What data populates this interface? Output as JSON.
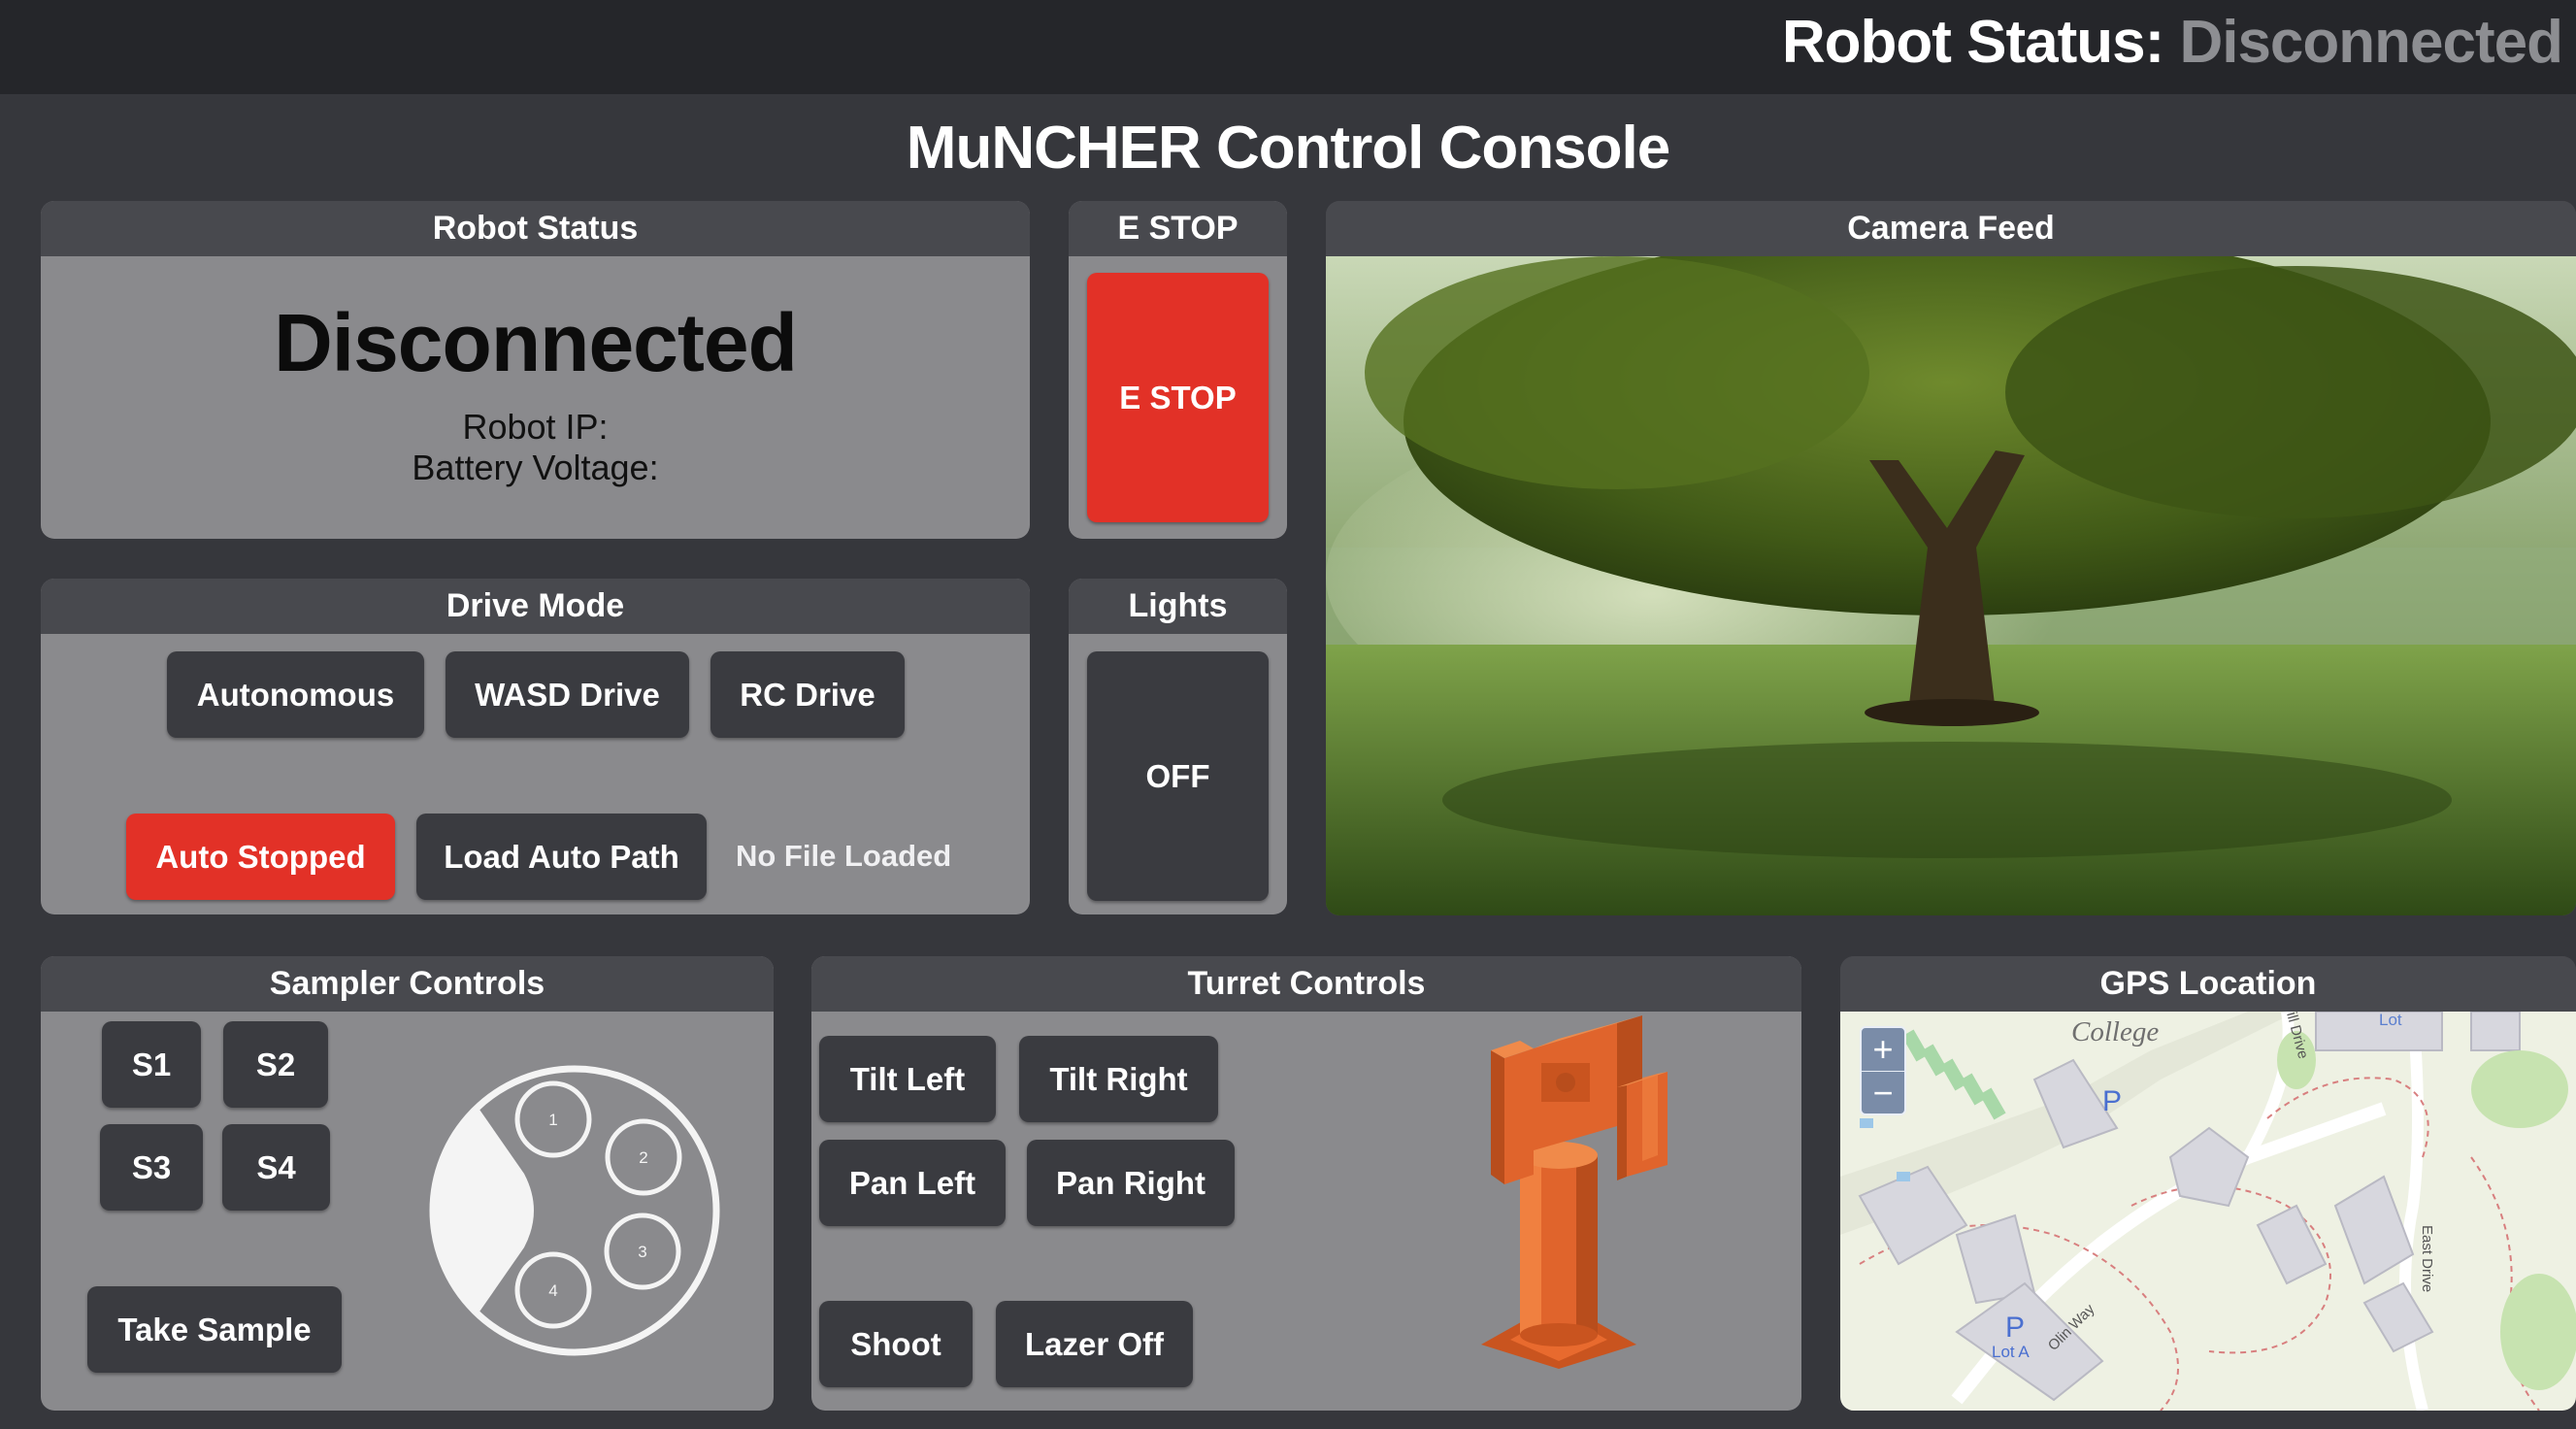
{
  "topbar": {
    "status_label": "Robot Status:",
    "status_value": "Disconnected"
  },
  "title": "MuNCHER Control Console",
  "robot_status": {
    "header": "Robot Status",
    "state": "Disconnected",
    "ip_label": "Robot IP:",
    "battery_label": "Battery Voltage:"
  },
  "estop": {
    "header": "E STOP",
    "button": "E STOP"
  },
  "camera": {
    "header": "Camera Feed"
  },
  "drive": {
    "header": "Drive Mode",
    "modes": [
      "Autonomous",
      "WASD Drive",
      "RC Drive"
    ],
    "auto_stopped": "Auto Stopped",
    "load_path": "Load Auto Path",
    "file_status": "No File Loaded"
  },
  "lights": {
    "header": "Lights",
    "button": "OFF"
  },
  "sampler": {
    "header": "Sampler Controls",
    "buttons": [
      "S1",
      "S2",
      "S3",
      "S4"
    ],
    "take_sample": "Take Sample",
    "slots": [
      "1",
      "2",
      "3",
      "4"
    ]
  },
  "turret": {
    "header": "Turret Controls",
    "tilt_left": "Tilt Left",
    "tilt_right": "Tilt Right",
    "pan_left": "Pan Left",
    "pan_right": "Pan Right",
    "shoot": "Shoot",
    "lazer": "Lazer Off"
  },
  "gps": {
    "header": "GPS Location",
    "zoom_in": "+",
    "zoom_out": "−",
    "labels": {
      "college": "College",
      "lot_top": "Lot",
      "parking": "P",
      "lot_a": "Lot A",
      "olin_way": "Olin Way",
      "east_drive": "East Drive",
      "hill_drive": "ill Drive"
    }
  },
  "colors": {
    "accent_red": "#e23127",
    "panel": "#8a8a8d",
    "panel_header": "#48494e",
    "button": "#3a3b40",
    "turret_model": "#e0642c"
  }
}
